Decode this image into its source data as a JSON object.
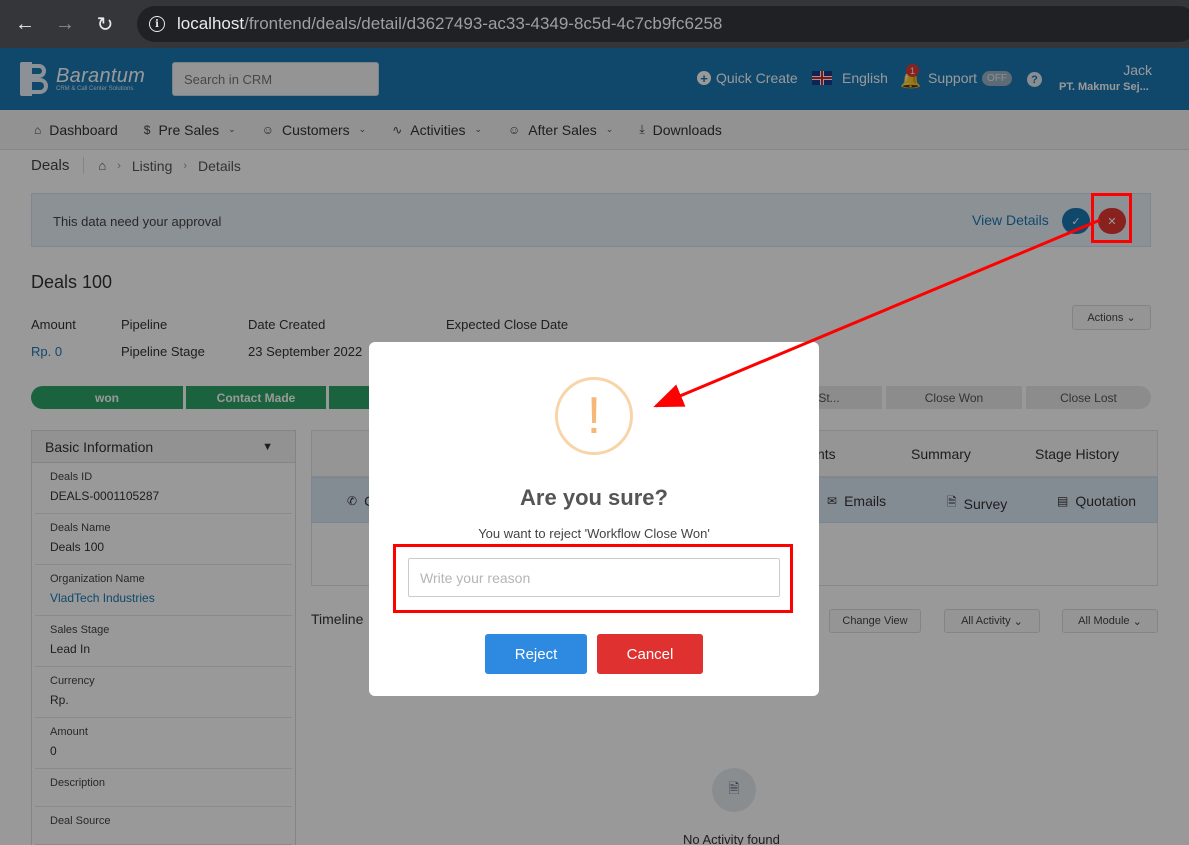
{
  "browser": {
    "back_icon": "arrow-left-icon",
    "forward_icon": "arrow-right-icon",
    "reload_icon": "reload-icon",
    "url_host": "localhost",
    "url_path": "/frontend/deals/detail/d3627493-ac33-4349-8c5d-4c7cb9fc6258"
  },
  "header": {
    "logo_name": "Barantum",
    "logo_sub": "CRM & Call Center Solutions",
    "search_placeholder": "Search in CRM",
    "quick_create": "Quick Create",
    "language": "English",
    "notification_count": "1",
    "support": "Support",
    "support_toggle": "OFF",
    "help": "?",
    "user_name": "Jack",
    "user_org": "PT. Makmur Sej..."
  },
  "nav": {
    "items": [
      {
        "label": "Dashboard",
        "icon": "home-icon",
        "dropdown": false
      },
      {
        "label": "Pre Sales",
        "icon": "dollar-icon",
        "dropdown": true
      },
      {
        "label": "Customers",
        "icon": "users-icon",
        "dropdown": true
      },
      {
        "label": "Activities",
        "icon": "activity-icon",
        "dropdown": true
      },
      {
        "label": "After Sales",
        "icon": "users-icon",
        "dropdown": true
      },
      {
        "label": "Downloads",
        "icon": "download-icon",
        "dropdown": false
      }
    ]
  },
  "breadcrumb": {
    "title": "Deals",
    "items": [
      "Listing",
      "Details"
    ]
  },
  "approval": {
    "message": "This data need your approval",
    "view_details": "View Details"
  },
  "deal": {
    "title": "Deals 100",
    "labels": {
      "amount": "Amount",
      "pipeline": "Pipeline",
      "date_created": "Date Created",
      "expected_close": "Expected Close Date"
    },
    "values": {
      "amount": "Rp. 0",
      "pipeline": "Pipeline Stage",
      "date_created": "23 September 2022"
    },
    "actions": "Actions"
  },
  "stages": {
    "done": [
      "won",
      "Contact Made"
    ],
    "todo": [
      "ns St...",
      "Close Won",
      "Close Lost"
    ]
  },
  "basic_info": {
    "title": "Basic Information",
    "fields": [
      {
        "label": "Deals ID",
        "value": "DEALS-0001105287"
      },
      {
        "label": "Deals Name",
        "value": "Deals 100"
      },
      {
        "label": "Organization Name",
        "value": "VladTech Industries"
      },
      {
        "label": "Sales Stage",
        "value": "Lead In"
      },
      {
        "label": "Currency",
        "value": "Rp."
      },
      {
        "label": "Amount",
        "value": "0"
      },
      {
        "label": "Description",
        "value": ""
      },
      {
        "label": "Deal Source",
        "value": ""
      }
    ]
  },
  "tabs": {
    "main": [
      "nts",
      "Summary",
      "Stage History"
    ],
    "sub": [
      "C",
      "Emails",
      "Survey",
      "Quotation"
    ]
  },
  "timeline": {
    "label": "Timeline",
    "change_view": "Change View",
    "all_activity": "All Activity",
    "all_module": "All Module",
    "empty": "No Activity found"
  },
  "modal": {
    "icon": "!",
    "title": "Are you sure?",
    "text": "You want to reject 'Workflow Close Won'",
    "reason_placeholder": "Write your reason",
    "reason_value": "",
    "reject": "Reject",
    "cancel": "Cancel"
  },
  "colors": {
    "header_blue": "#1c79b5",
    "stage_green": "#2ea66a",
    "reject_blue": "#2d8ae0",
    "cancel_red": "#e03131",
    "annotation_red": "#ff0000"
  }
}
